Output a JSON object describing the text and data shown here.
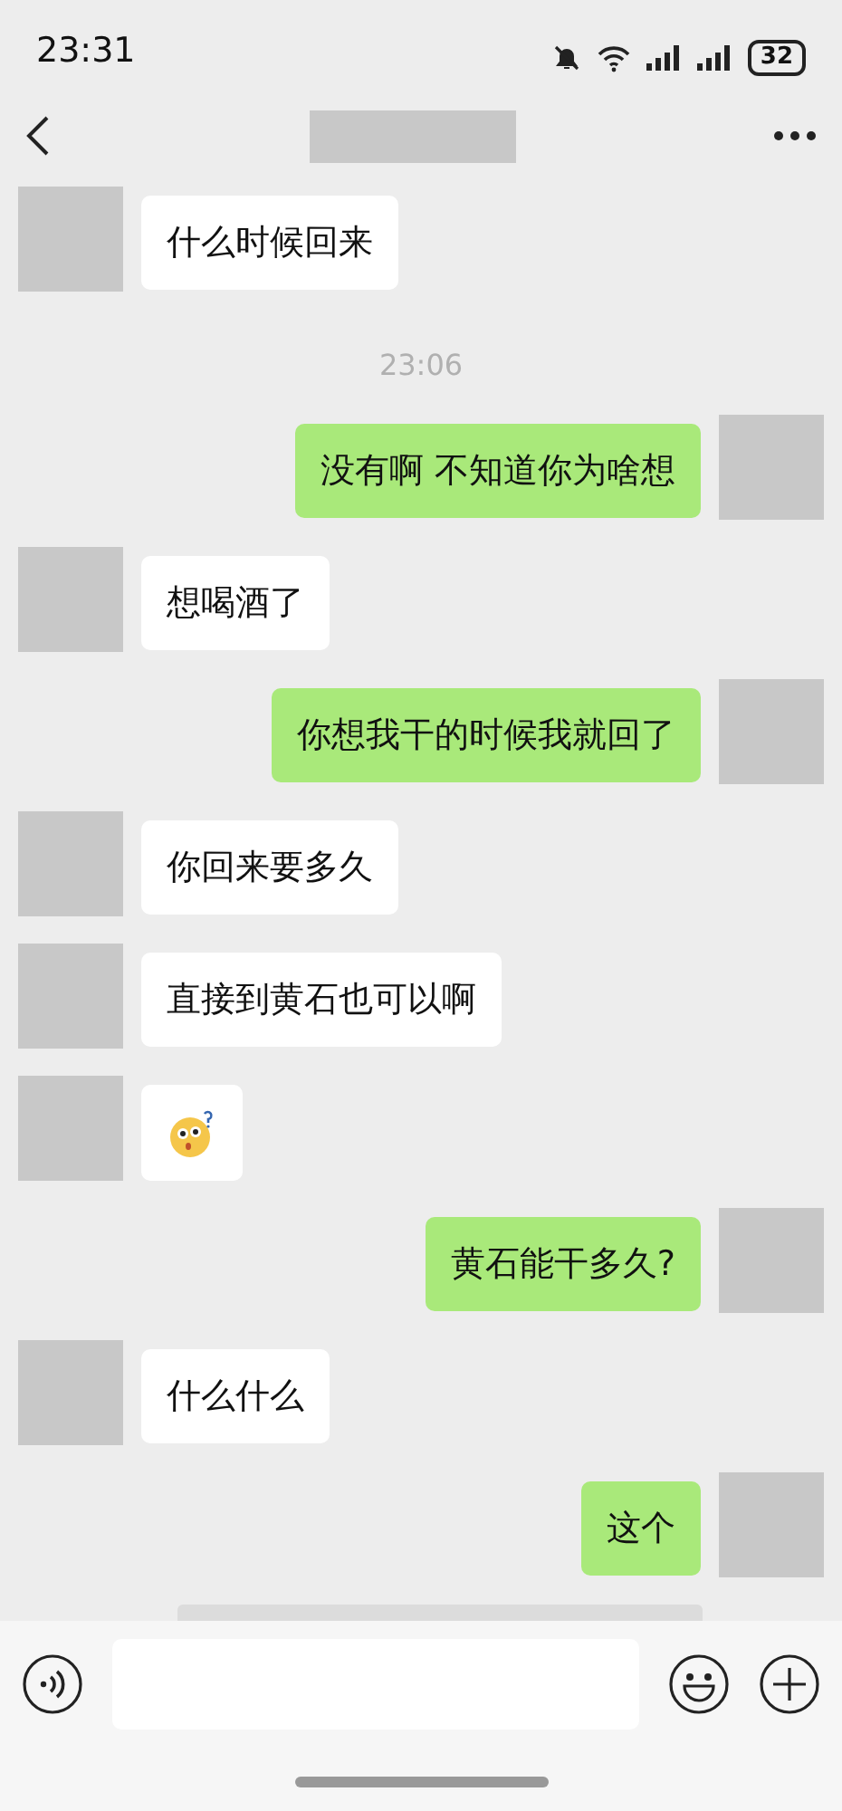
{
  "status_bar": {
    "time": "23:31",
    "battery": "32"
  },
  "messages": [
    {
      "kind": "text",
      "outgoing": false,
      "text": "什么时候回来"
    },
    {
      "kind": "time",
      "text": "23:06"
    },
    {
      "kind": "text",
      "outgoing": true,
      "text": "没有啊  不知道你为啥想"
    },
    {
      "kind": "text",
      "outgoing": false,
      "text": "想喝酒了"
    },
    {
      "kind": "text",
      "outgoing": true,
      "text": "你想我干的时候我就回了"
    },
    {
      "kind": "text",
      "outgoing": false,
      "text": "你回来要多久"
    },
    {
      "kind": "text",
      "outgoing": false,
      "text": "直接到黄石也可以啊"
    },
    {
      "kind": "emoji",
      "outgoing": false
    },
    {
      "kind": "text",
      "outgoing": true,
      "text": "黄石能干多久?"
    },
    {
      "kind": "text",
      "outgoing": false,
      "text": "什么什么"
    },
    {
      "kind": "text",
      "outgoing": true,
      "text": "这个"
    }
  ]
}
